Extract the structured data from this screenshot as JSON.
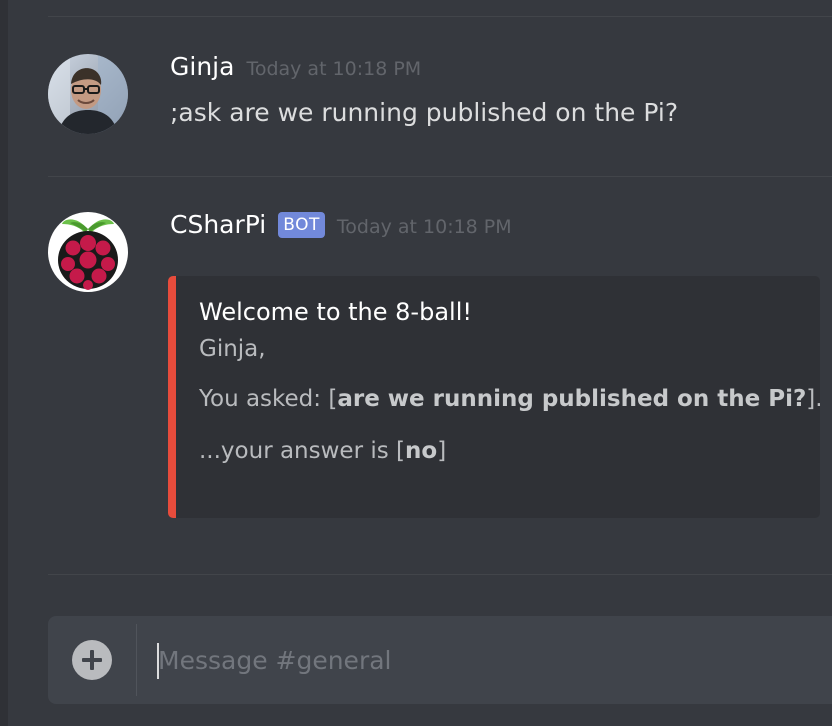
{
  "messages": [
    {
      "author": "Ginja",
      "timestamp": "Today at 10:18 PM",
      "content": ";ask are we running published on the Pi?",
      "avatar_icon": "user-photo"
    },
    {
      "author": "CSharPi",
      "bot_tag": "BOT",
      "timestamp": "Today at 10:18 PM",
      "avatar_icon": "raspberry-pi-logo",
      "embed": {
        "accent_color": "#e74c3c",
        "title": "Welcome to the 8-ball!",
        "greeting": "Ginja,",
        "question_prefix": "You asked: [",
        "question": "are we running published on the Pi?",
        "question_suffix": "]...",
        "answer_prefix": "...your answer is [",
        "answer": "no",
        "answer_suffix": "]"
      }
    }
  ],
  "composer": {
    "placeholder": "Message #general",
    "value": "",
    "add_icon": "plus-circle-icon"
  },
  "colors": {
    "background": "#36393f",
    "embed_background": "#2f3136",
    "bot_tag": "#7289da",
    "timestamp": "#62656b"
  }
}
